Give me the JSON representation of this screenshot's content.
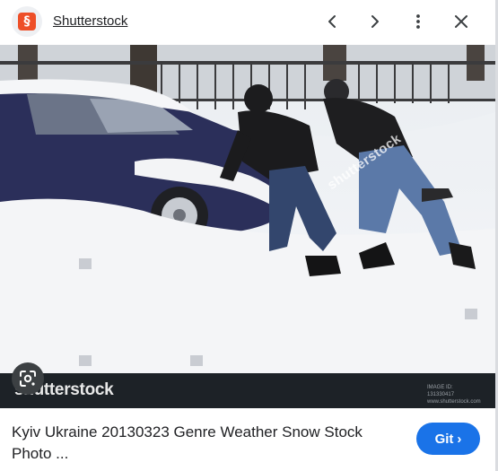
{
  "header": {
    "site_icon_glyph": "§",
    "site_name": "Shutterstock",
    "prev_icon": "chevron-left-icon",
    "next_icon": "chevron-right-icon",
    "more_icon": "more-vert-icon",
    "close_icon": "close-icon"
  },
  "image": {
    "watermark_center": "shutterstock",
    "watermark_brand": "shutterstock",
    "watermark_meta": "IMAGE ID: 131330417 www.shutterstock.com",
    "lens_icon": "lens-search-icon"
  },
  "footer": {
    "caption": "Kyiv Ukraine 20130323 Genre Weather Snow Stock Photo ...",
    "visit_label": "Git",
    "visit_chevron": "›"
  },
  "colors": {
    "accent": "#1a73e8",
    "site_icon": "#ee4f28",
    "watermark_bar": "#1d2227"
  }
}
